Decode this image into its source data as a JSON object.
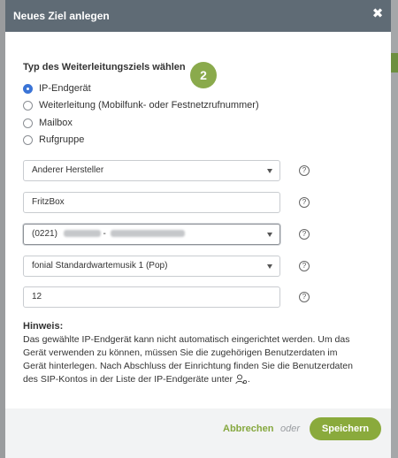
{
  "modal": {
    "title": "Neues Ziel anlegen",
    "close_icon": "close-icon"
  },
  "section": {
    "title": "Typ des Weiterleitungsziels wählen",
    "step": "2"
  },
  "radios": [
    {
      "label": "IP-Endgerät",
      "checked": true
    },
    {
      "label": "Weiterleitung (Mobilfunk- oder Festnetzrufnummer)",
      "checked": false
    },
    {
      "label": "Mailbox",
      "checked": false
    },
    {
      "label": "Rufgruppe",
      "checked": false
    }
  ],
  "fields": {
    "manufacturer": "Anderer Hersteller",
    "device_name": "FritzBox",
    "number_prefix": "(0221)",
    "number_separator": "-",
    "music": "fonial Standardwartemusik 1 (Pop)",
    "ring_seconds": "12"
  },
  "help_glyph": "?",
  "hint": {
    "title": "Hinweis:",
    "text": "Das gewählte IP-Endgerät kann nicht automatisch eingerichtet werden. Um das Gerät verwenden zu können, müssen Sie die zugehörigen Benutzerdaten im Gerät hinterlegen. Nach Abschluss der Einrichtung finden Sie die Benutzerdaten des SIP-Kontos in der Liste der IP-Endgeräte unter",
    "icon": "user-settings-icon"
  },
  "footer": {
    "cancel_label": "Abbrechen",
    "or_label": "oder",
    "save_label": "Speichern"
  },
  "colors": {
    "header": "#5f6b75",
    "accent_green": "#8aaa3c",
    "radio_blue": "#3b74d6"
  }
}
